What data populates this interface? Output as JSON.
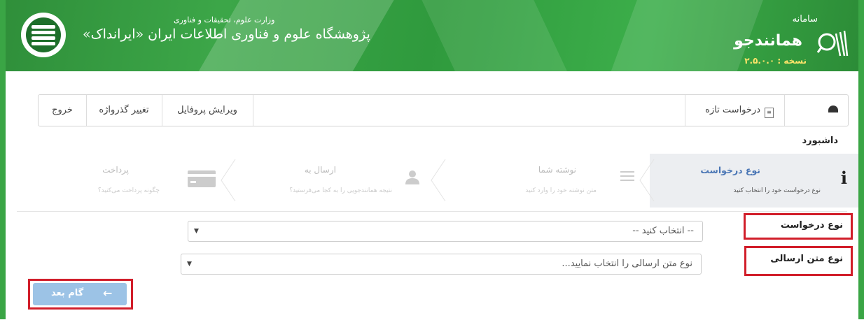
{
  "header": {
    "ministry": "وزارت علوم، تحقیقات و فناوری",
    "institute": "پژوهشگاه علوم و فناوری اطلاعات ایران  «ایرانداک»",
    "system_small": "سامانه",
    "system_title": "همانندجو",
    "version": "نسخه : ۲.۵.۰.۰"
  },
  "nav": {
    "dashboard": "داشبورد",
    "new_request": "درخواست تازه",
    "edit_profile": "ویرایش پروفایل",
    "change_password": "تغییر گذرواژه",
    "exit": "خروج"
  },
  "steps": [
    {
      "title": "نوع درخواست",
      "sub": "نوع درخواست خود را انتخاب کنید",
      "icon": "info-icon",
      "active": true
    },
    {
      "title": "نوشته شما",
      "sub": "متن نوشته خود را وارد کنید",
      "icon": "text-lines-icon",
      "active": false
    },
    {
      "title": "ارسال به",
      "sub": "نتیجه همانندجویی را به کجا می‌فرستید؟",
      "icon": "user-icon",
      "active": false
    },
    {
      "title": "پرداخت",
      "sub": "چگونه پرداخت می‌کنید؟",
      "icon": "credit-card-icon",
      "active": false
    }
  ],
  "form": {
    "request_type_label": "نوع درخواست",
    "request_type_value": "-- انتخاب کنید --",
    "text_type_label": "نوع متن ارسالی",
    "text_type_placeholder": "نوع متن ارسالی را انتخاب نمایید...",
    "next_button": "گام بعد"
  },
  "colors": {
    "brand_green": "#3aa545",
    "highlight": "#d11e2a",
    "button": "#9cc3e6",
    "active_step": "#4a76b5"
  }
}
